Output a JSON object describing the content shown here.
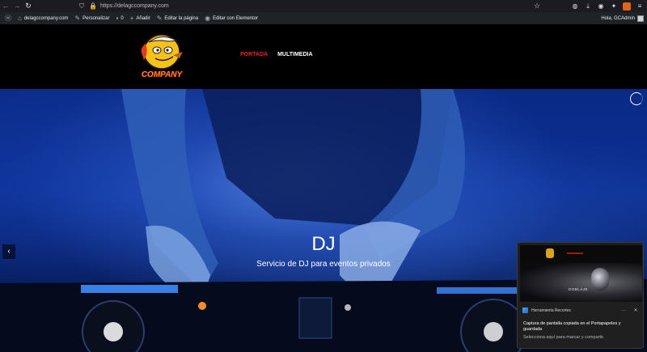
{
  "browser": {
    "url": "https://delagccompany.com",
    "back_icon": "←",
    "forward_icon": "→",
    "reload_icon": "↻",
    "shield_icon": "⛉",
    "lock_icon": "🔒",
    "bookmark_star": "☆",
    "pocket_icon": "◍",
    "downloads_icon": "⤓",
    "account_icon": "◉",
    "extensions_icon": "✦",
    "menu_icon": "≡"
  },
  "admin_bar": {
    "wp_logo": "ⓦ",
    "site_name": "delagccompany.com",
    "customize": "Personalizar",
    "comments_count": "0",
    "add_new": "Añadir",
    "edit_page": "Editar la página",
    "edit_elementor": "Editar con Elementor",
    "greeting": "Hola, GCAdmin"
  },
  "site": {
    "logo_text": "COMPANY",
    "menu": [
      {
        "label": "PORTADA"
      },
      {
        "label": "MULTIMEDIA"
      }
    ]
  },
  "hero": {
    "title": "DJ",
    "subtitle": "Servicio de DJ para eventos privados",
    "prev_arrow": "‹"
  },
  "notification": {
    "app_name": "Herramienta Recortes",
    "more": "···",
    "close": "✕",
    "message": "Captura de pantalla copiada en el Portapapeles y guardada",
    "hint": "Selecciona aquí para marcar y compartir.",
    "thumb_text": "DOBLAJE"
  },
  "colors": {
    "menu_active": "#e6232b",
    "menu_default": "#ffffff",
    "admin_bar_bg": "#1d2327",
    "browser_bar_bg": "#1c1b22",
    "hero_blue": "#0c2f92"
  }
}
